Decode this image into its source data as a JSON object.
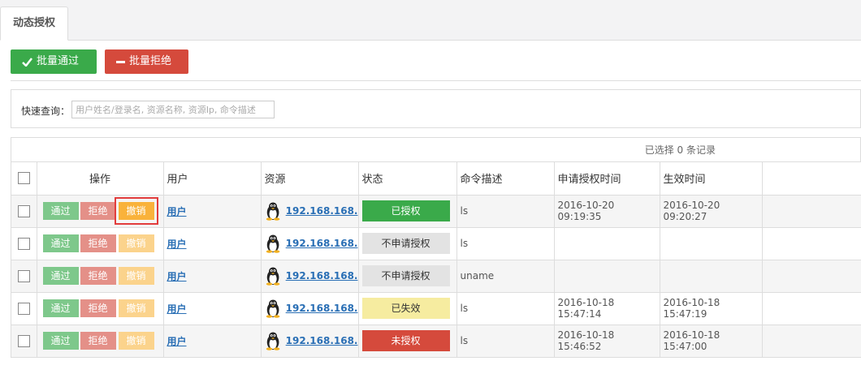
{
  "tab": {
    "label": "动态授权"
  },
  "toolbar": {
    "approve_label": "批量通过",
    "reject_label": "批量拒绝"
  },
  "search": {
    "label": "快速查询：",
    "placeholder": "用户姓名/登录名, 资源名称, 资源Ip, 命令描述"
  },
  "table": {
    "selected_info": "已选择 0 条记录",
    "headers": {
      "action": "操作",
      "user": "用户",
      "resource": "资源",
      "status": "状态",
      "command": "命令描述",
      "apply_time": "申请授权时间",
      "effective_time": "生效时间"
    },
    "op_labels": {
      "pass": "通过",
      "reject": "拒绝",
      "revoke": "撤销"
    },
    "rows": [
      {
        "user": "用户",
        "resource": "192.168.168.",
        "status": "已授权",
        "command": "ls",
        "apply_time": "2016-10-20 09:19:35",
        "effective_time": "2016-10-20 09:20:27"
      },
      {
        "user": "用户",
        "resource": "192.168.168.",
        "status": "不申请授权",
        "command": "ls",
        "apply_time": "",
        "effective_time": ""
      },
      {
        "user": "用户",
        "resource": "192.168.168.",
        "status": "不申请授权",
        "command": "uname",
        "apply_time": "",
        "effective_time": ""
      },
      {
        "user": "用户",
        "resource": "192.168.168.",
        "status": "已失效",
        "command": "ls",
        "apply_time": "2016-10-18 15:47:14",
        "effective_time": "2016-10-18 15:47:19"
      },
      {
        "user": "用户",
        "resource": "192.168.168.",
        "status": "未授权",
        "command": "ls",
        "apply_time": "2016-10-18 15:46:52",
        "effective_time": "2016-10-18 15:47:00"
      }
    ]
  },
  "colors": {
    "approve": "#3aaa4a",
    "reject": "#d54a3c",
    "revoke_active": "#f9b23b",
    "link": "#2a6fb5",
    "status_expired": "#f6eca0",
    "status_none": "#e3e3e3"
  },
  "icons": {
    "resource": "linux-penguin-icon"
  }
}
